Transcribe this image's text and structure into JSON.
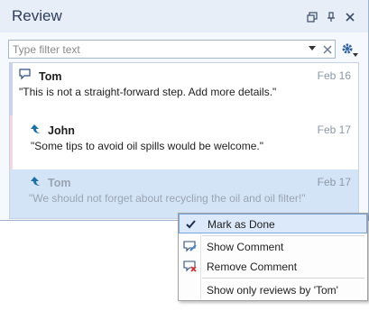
{
  "panel": {
    "title": "Review"
  },
  "filter": {
    "placeholder": "Type filter text",
    "value": ""
  },
  "reviews": [
    {
      "author": "Tom",
      "date": "Feb 16",
      "text": "\"This is not a straight-forward step. Add more details.\"",
      "type": "comment"
    },
    {
      "author": "John",
      "date": "Feb 17",
      "text": "\"Some tips to avoid oil spills would be welcome.\"",
      "type": "reply"
    },
    {
      "author": "Tom",
      "date": "Feb 17",
      "text": "\"We should not forget about recycling the oil and oil filter!\"",
      "type": "reply",
      "done": true
    }
  ],
  "context_menu": {
    "mark_done": "Mark as Done",
    "show_comment": "Show Comment",
    "remove_comment": "Remove Comment",
    "show_only": "Show only reviews by 'Tom'"
  },
  "colors": {
    "accent_tom": "#c9d3ea",
    "accent_john": "#f2d9df",
    "highlight": "#dbe9fa"
  }
}
